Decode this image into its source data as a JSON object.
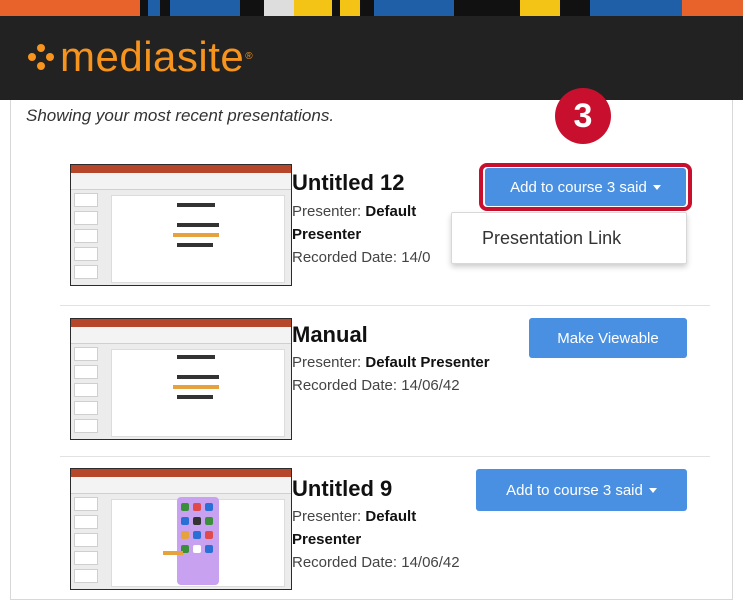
{
  "app": {
    "logo_text": "mediasite",
    "logo_registered": "®",
    "intro_text": "Showing your most recent presentations.",
    "step_number": "3"
  },
  "colors": {
    "header_bg": "#222222",
    "logo_orange": "#f7941d",
    "button_blue": "#4a90e2",
    "highlight_red": "#c8102e"
  },
  "presentations": [
    {
      "title": "Untitled 12",
      "presenter_label": "Presenter:",
      "presenter_line1": "Default",
      "presenter_line2": "Presenter",
      "recorded_label": "Recorded Date: 14/0",
      "action_label": "Add to course 3 said",
      "action_has_caret": true
    },
    {
      "title": "Manual",
      "presenter_label": "Presenter:",
      "presenter_value": "Default Presenter",
      "recorded_label": "Recorded Date: 14/06/42",
      "action_label": "Make Viewable"
    },
    {
      "title": "Untitled 9",
      "presenter_label": "Presenter:",
      "presenter_line1": "Default",
      "presenter_line2": "Presenter",
      "recorded_label": "Recorded Date: 14/06/42",
      "action_label": "Add to course 3 said",
      "action_has_caret": true
    }
  ],
  "dropdown": {
    "items": [
      "Presentation Link"
    ]
  }
}
